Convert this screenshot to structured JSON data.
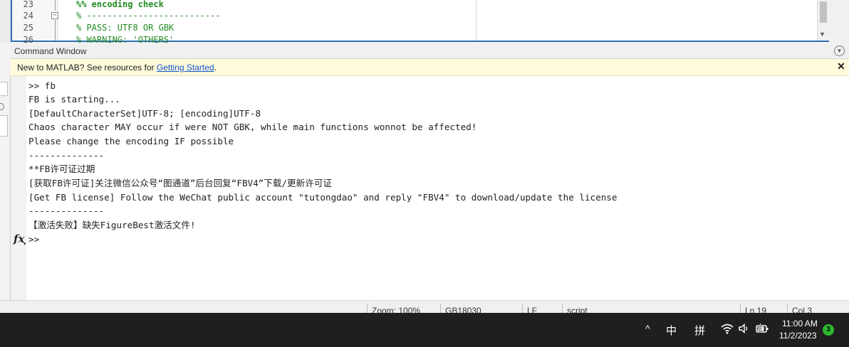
{
  "editor": {
    "lines": [
      {
        "number": "23",
        "text": "%% encoding check",
        "bold": true
      },
      {
        "number": "24",
        "text": "% --------------------------",
        "bold": false
      },
      {
        "number": "25",
        "text": "% PASS: UTF8 OR GBK",
        "bold": false
      },
      {
        "number": "26",
        "text": "% WARNING: 'OTHERS'",
        "bold": false
      }
    ],
    "fold_symbol": "−"
  },
  "command_window": {
    "title": "Command Window",
    "notice": {
      "prefix": "New to MATLAB? See resources for ",
      "link": "Getting Started",
      "suffix": "."
    },
    "output_lines": [
      ">> fb",
      "FB is starting...",
      "[DefaultCharacterSet]UTF-8; [encoding]UTF-8",
      "Chaos character MAY occur if were NOT GBK, while main functions wonnot be affected!",
      "Please change the encoding IF possible",
      "--------------",
      "**FB许可证过期",
      "[获取FB许可证]关注微信公众号“图通道”后台回复“FBV4”下载/更新许可证",
      "[Get FB license] Follow the WeChat public account \"tutongdao\" and reply \"FBV4\" to download/update the license",
      "--------------",
      "【激活失败】缺失FigureBest激活文件!",
      ">>"
    ],
    "fx_label": "fx",
    "fx_caret": "▾"
  },
  "status_bar": {
    "zoom": "Zoom: 100%",
    "encoding": "GB18030",
    "line_ending": "LF",
    "file_type": "script",
    "line": "Ln  19",
    "column": "Col  3"
  },
  "taskbar": {
    "tray_chevron": "^",
    "ime_language": "中",
    "ime_mode": "拼",
    "time": "11:00 AM",
    "date": "11/2/2023",
    "notification_count": "3"
  }
}
